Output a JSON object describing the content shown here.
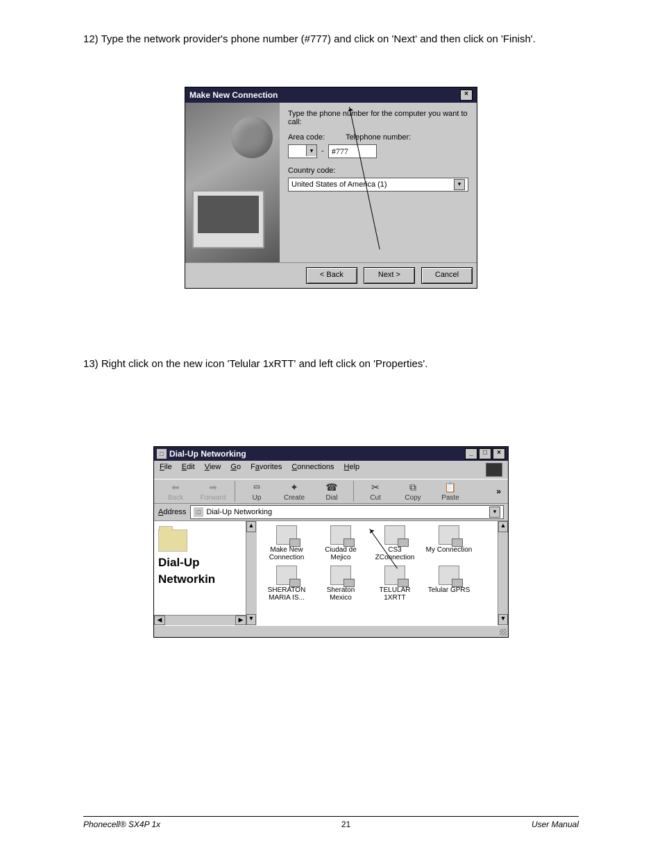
{
  "steps": {
    "s12": "12)  Type the network provider's phone number (#777) and click on 'Next' and then click on 'Finish'.",
    "s13": "13)  Right click on the new icon 'Telular 1xRTT' and left click on 'Properties'."
  },
  "dialog1": {
    "title": "Make New Connection",
    "prompt": "Type the phone number for the computer you want to call:",
    "area_label": "Area code:",
    "tel_label": "Telephone number:",
    "tel_value": "#777",
    "country_label": "Country code:",
    "country_value": "United States of America (1)",
    "btn_back": "< Back",
    "btn_next": "Next >",
    "btn_cancel": "Cancel"
  },
  "win2": {
    "title": "Dial-Up Networking",
    "menus": {
      "file": "File",
      "edit": "Edit",
      "view": "View",
      "go": "Go",
      "fav": "Favorites",
      "conn": "Connections",
      "help": "Help"
    },
    "toolbar": {
      "back": "Back",
      "forward": "Forward",
      "up": "Up",
      "create": "Create",
      "dial": "Dial",
      "cut": "Cut",
      "copy": "Copy",
      "paste": "Paste"
    },
    "address_label": "Address",
    "address_value": "Dial-Up Networking",
    "left_title1": "Dial-Up",
    "left_title2": "Networkin",
    "items": [
      {
        "l1": "Make New",
        "l2": "Connection"
      },
      {
        "l1": "Ciudad de",
        "l2": "Mejico"
      },
      {
        "l1": "CS3",
        "l2": "ZConnection"
      },
      {
        "l1": "My Connection",
        "l2": ""
      },
      {
        "l1": "SHERATON",
        "l2": "MARIA IS..."
      },
      {
        "l1": "Sheraton",
        "l2": "Mexico"
      },
      {
        "l1": "TELULAR",
        "l2": "1XRTT"
      },
      {
        "l1": "Telular GPRS",
        "l2": ""
      }
    ]
  },
  "footer": {
    "left": "Phonecell® SX4P 1x",
    "center": "21",
    "right": "User Manual"
  }
}
